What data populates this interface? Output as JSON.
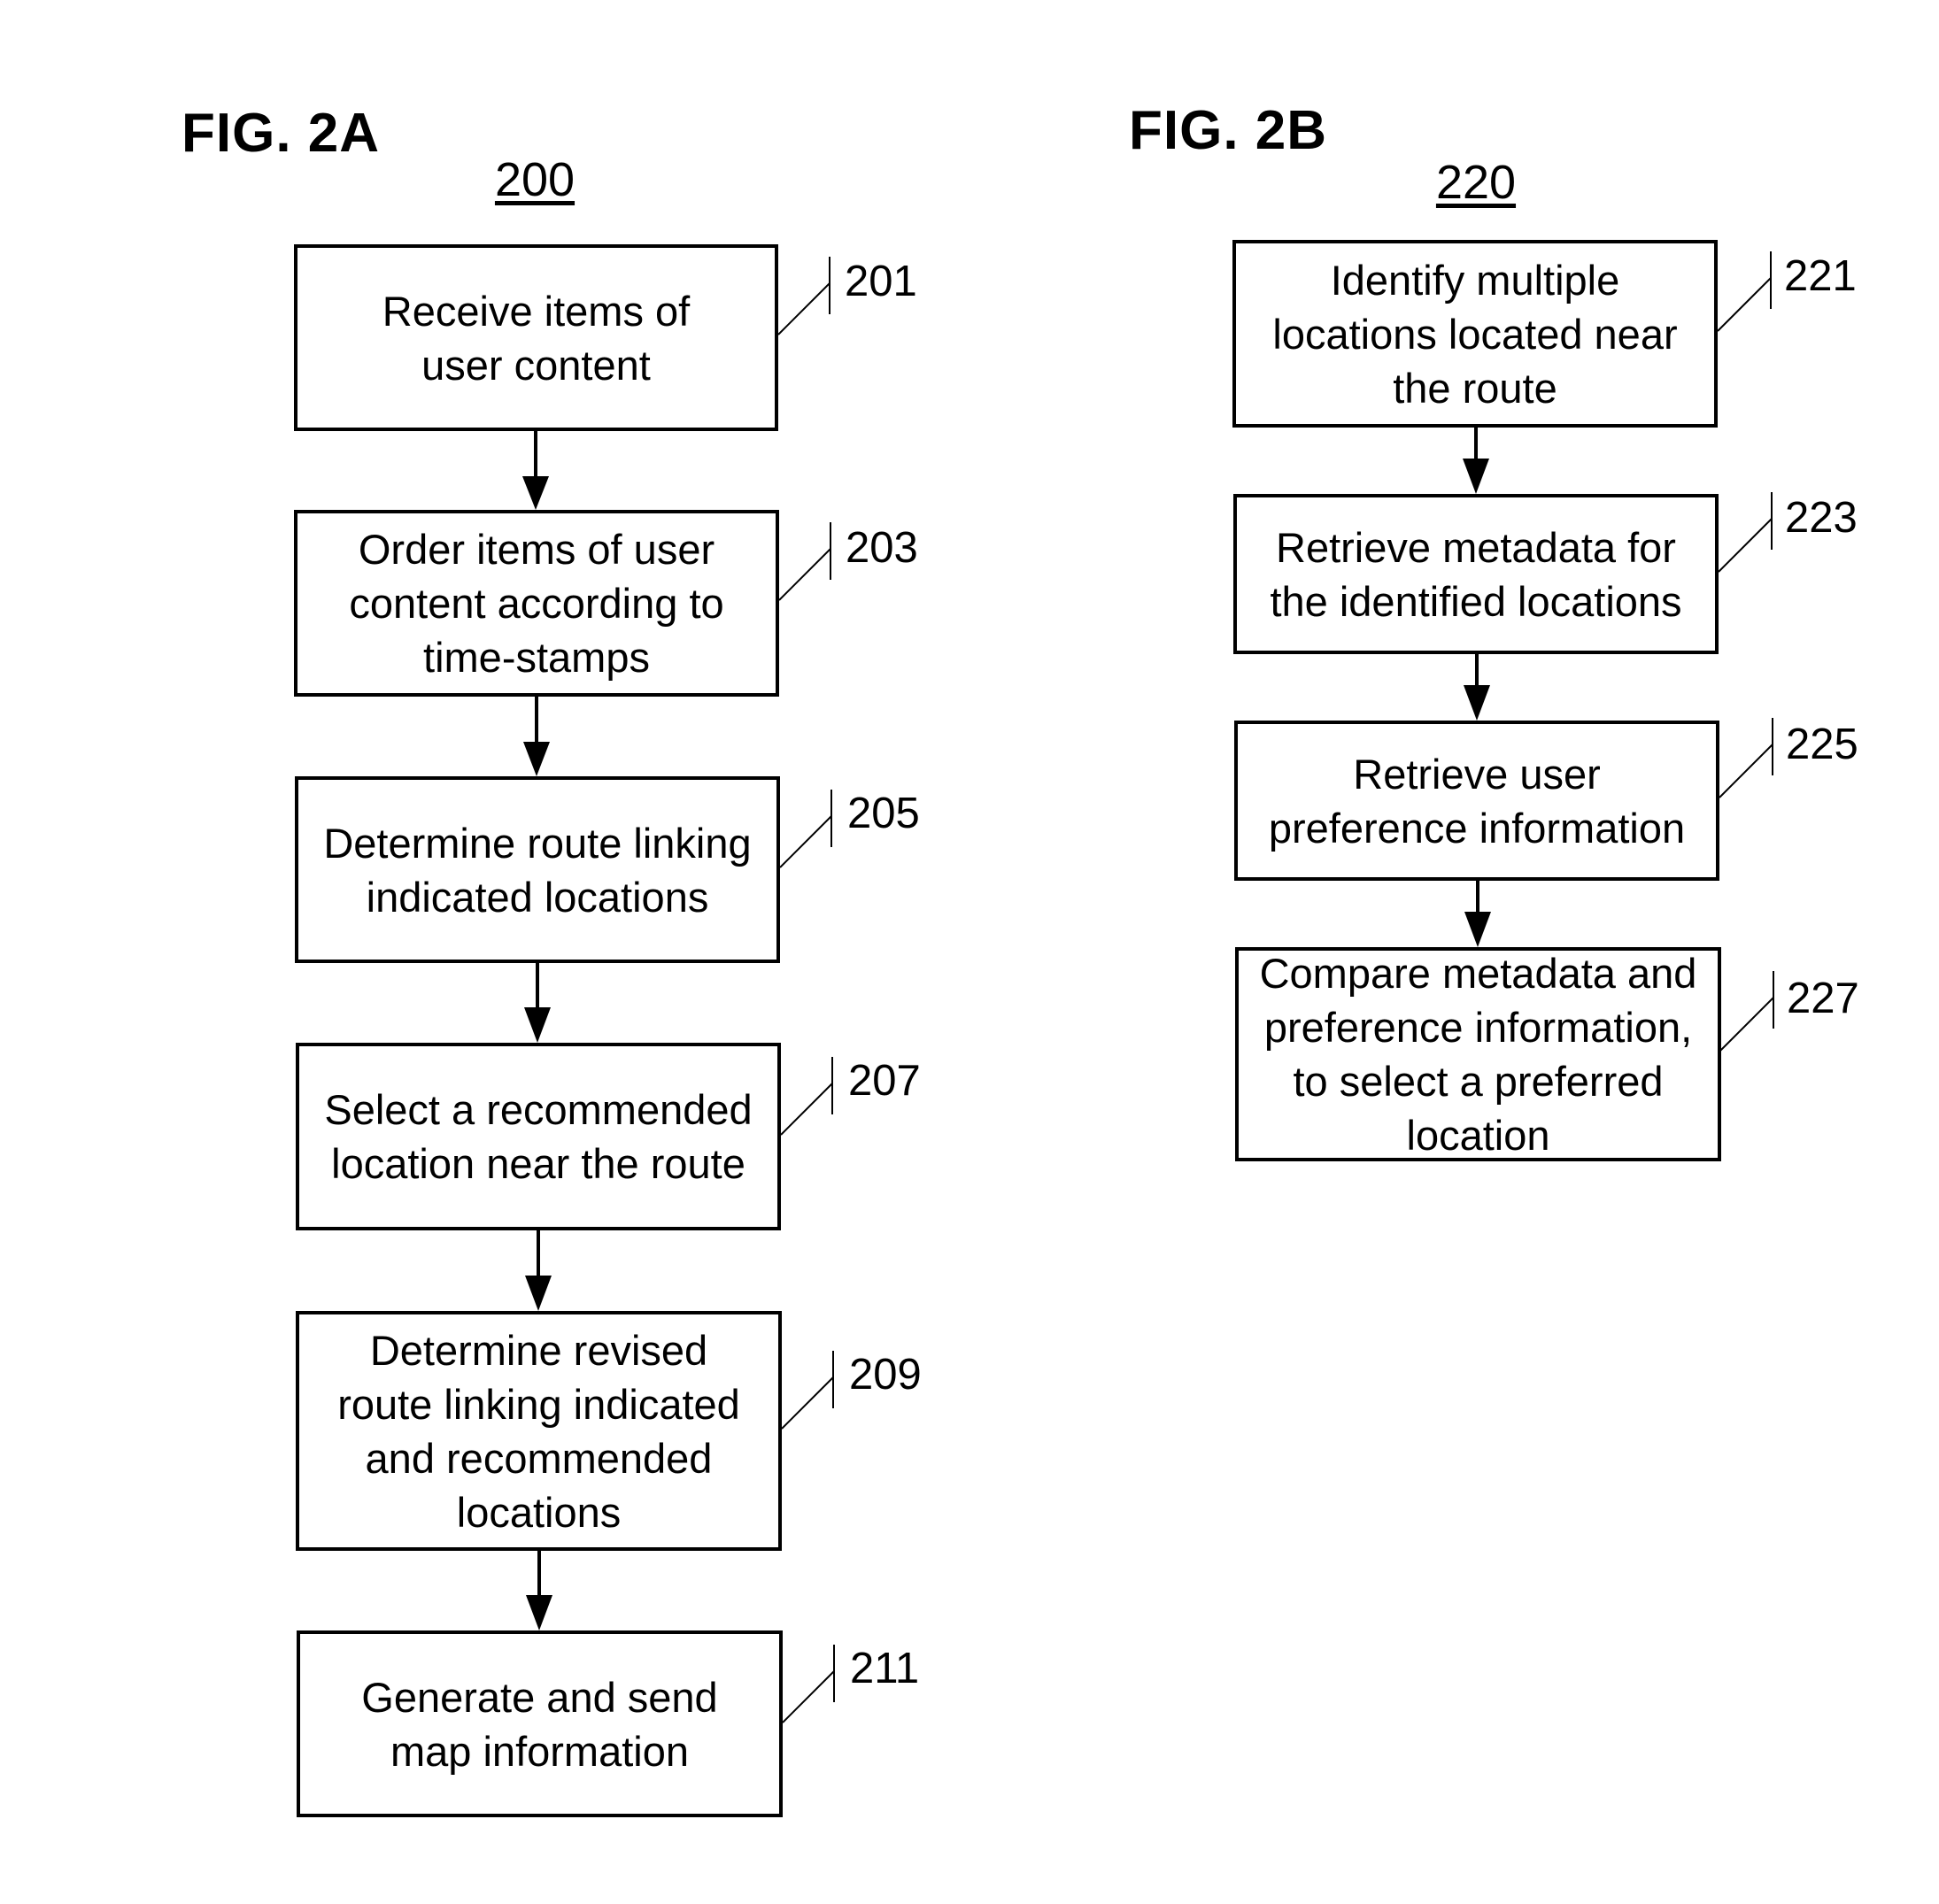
{
  "fig_a": {
    "title": "FIG. 2A",
    "number": "200",
    "steps": [
      {
        "ref": "201",
        "text": "Receive items of user content"
      },
      {
        "ref": "203",
        "text": "Order items of user content according to time-stamps"
      },
      {
        "ref": "205",
        "text": "Determine route linking indicated locations"
      },
      {
        "ref": "207",
        "text": "Select a recommended location near the route"
      },
      {
        "ref": "209",
        "text": "Determine revised route linking indicated and recommended locations"
      },
      {
        "ref": "211",
        "text": "Generate and send map information"
      }
    ]
  },
  "fig_b": {
    "title": "FIG. 2B",
    "number": "220",
    "steps": [
      {
        "ref": "221",
        "text": "Identify multiple locations located near the route"
      },
      {
        "ref": "223",
        "text": "Retrieve metadata for the identified locations"
      },
      {
        "ref": "225",
        "text": "Retrieve user preference information"
      },
      {
        "ref": "227",
        "text": "Compare metadata and preference information, to select a preferred location"
      }
    ]
  }
}
